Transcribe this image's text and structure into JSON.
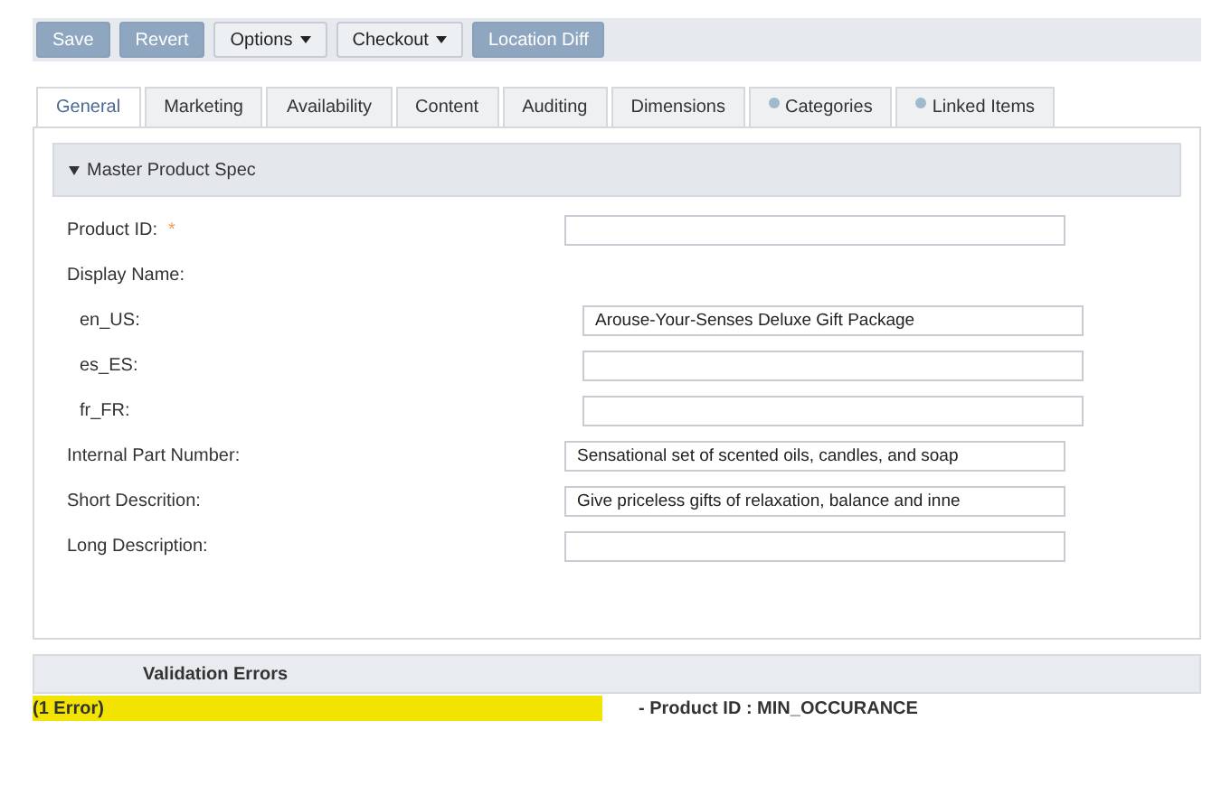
{
  "toolbar": [
    {
      "label": "Save",
      "disabled": true,
      "dropdown": false
    },
    {
      "label": "Revert",
      "disabled": true,
      "dropdown": false
    },
    {
      "label": "Options",
      "disabled": false,
      "dropdown": true
    },
    {
      "label": "Checkout",
      "disabled": false,
      "dropdown": true
    },
    {
      "label": "Location Diff",
      "disabled": true,
      "dropdown": false
    }
  ],
  "tabs": [
    {
      "label": "General",
      "selected": true,
      "icon": false
    },
    {
      "label": "Marketing",
      "selected": false,
      "icon": false
    },
    {
      "label": "Availability",
      "selected": false,
      "icon": false
    },
    {
      "label": "Content",
      "selected": false,
      "icon": false
    },
    {
      "label": "Auditing",
      "selected": false,
      "icon": false
    },
    {
      "label": "Dimensions",
      "selected": false,
      "icon": false
    },
    {
      "label": "Categories",
      "selected": false,
      "icon": true
    },
    {
      "label": "Linked Items",
      "selected": false,
      "icon": true
    }
  ],
  "section": {
    "title": "Master Product Spec",
    "expanded": true
  },
  "fields": [
    {
      "kind": "field",
      "label": "Product ID:",
      "required_mark": "*"
    },
    {
      "kind": "heading",
      "label": "Display Name:"
    },
    {
      "kind": "subfield",
      "label": "en_US:",
      "value": "Arouse-Your-Senses Deluxe Gift Package"
    },
    {
      "kind": "subfield",
      "label": "es_ES:"
    },
    {
      "kind": "subfield",
      "label": "fr_FR:"
    },
    {
      "kind": "field",
      "label": "Internal Part Number:",
      "value": "Sensational set of scented oils, candles, and soap"
    },
    {
      "kind": "field",
      "label": "Short Descrition:",
      "value": "Give priceless gifts of relaxation, balance and inne"
    },
    {
      "kind": "field",
      "label": "Long Description:"
    }
  ],
  "validation": {
    "title": "Validation Errors",
    "count": "(1 Error)",
    "message": "- Product ID : MIN_OCCURANCE"
  }
}
